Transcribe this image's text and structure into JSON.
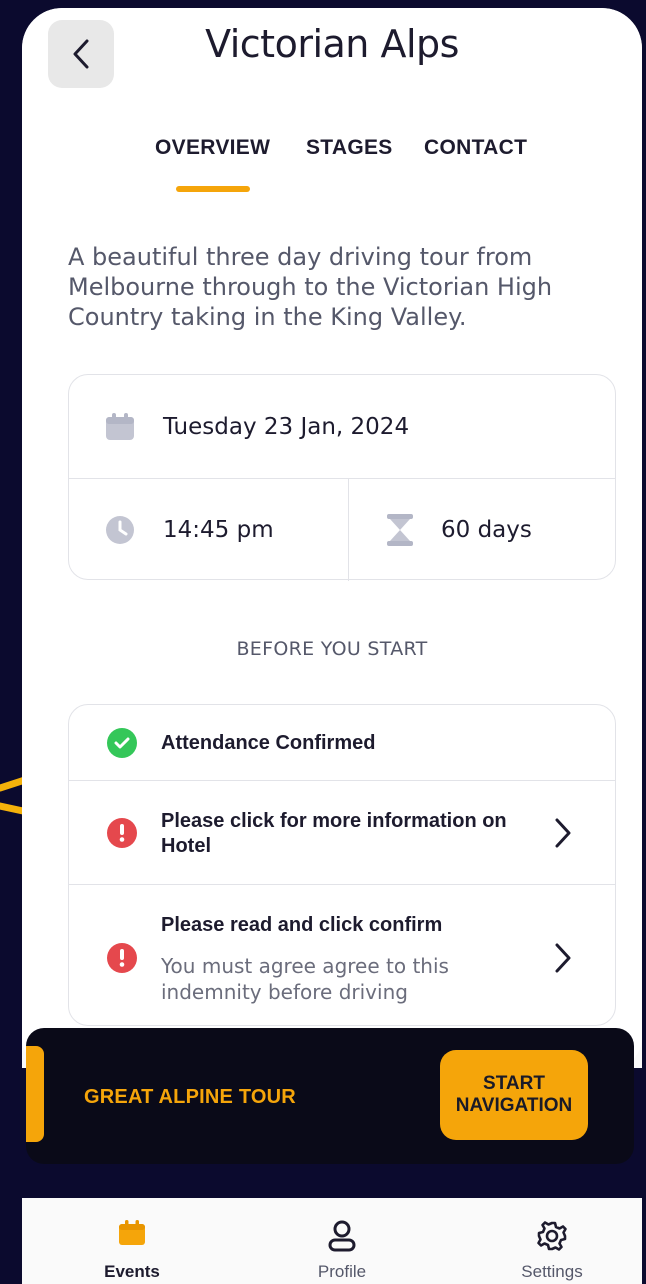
{
  "header": {
    "title": "Victorian Alps",
    "back_icon": "chevron-left-icon"
  },
  "tabs": [
    {
      "label": "OVERVIEW",
      "active": true
    },
    {
      "label": "STAGES",
      "active": false
    },
    {
      "label": "CONTACT",
      "active": false
    }
  ],
  "description": "A beautiful three day driving tour from Melbourne through to the Victorian High Country taking in the King Valley.",
  "info": {
    "date": "Tuesday 23 Jan, 2024",
    "time": "14:45 pm",
    "duration": "60 days"
  },
  "section_heading": "BEFORE YOU START",
  "checklist": [
    {
      "title": "Attendance Confirmed",
      "status": "confirmed"
    },
    {
      "title": "Please click for more information on Hotel",
      "status": "action-required"
    },
    {
      "title": "Please read and click confirm",
      "subtitle": "You must agree agree to this indemnity before driving",
      "status": "action-required"
    }
  ],
  "banner": {
    "title": "GREAT ALPINE TOUR",
    "button_label": "START\nNAVIGATION"
  },
  "tabbar": [
    {
      "label": "Events",
      "icon": "calendar-icon",
      "active": true
    },
    {
      "label": "Profile",
      "icon": "user-icon",
      "active": false
    },
    {
      "label": "Settings",
      "icon": "gear-icon",
      "active": false
    }
  ],
  "colors": {
    "accent": "#f5a50a",
    "background": "#0b0a2e",
    "success": "#34c759",
    "error": "#e5484d",
    "annotation_arrow": "#f5b20a"
  }
}
